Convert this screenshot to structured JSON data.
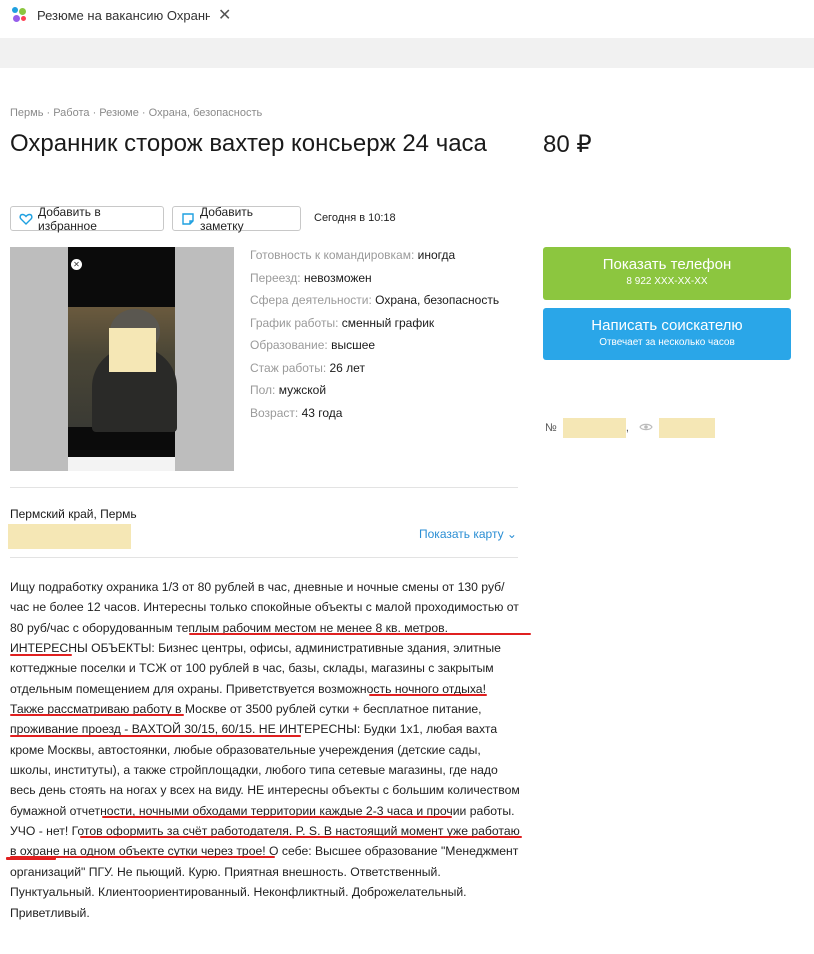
{
  "browser": {
    "tab_title": "Резюме на вакансию Охранник",
    "tab_close": "✕"
  },
  "breadcrumb": "Пермь · Работа · Резюме · Охрана, безопасность",
  "title": "Охранник сторож вахтер консьерж 24 часа",
  "price": "80 ₽",
  "actions": {
    "favorite": "Добавить в избранное",
    "note": "Добавить заметку",
    "date": "Сегодня в 10:18"
  },
  "params": [
    {
      "key": "Готовность к командировкам:",
      "value": "иногда"
    },
    {
      "key": "Переезд:",
      "value": "невозможен"
    },
    {
      "key": "Сфера деятельности:",
      "value": "Охрана, безопасность"
    },
    {
      "key": "График работы:",
      "value": "сменный график"
    },
    {
      "key": "Образование:",
      "value": "высшее"
    },
    {
      "key": "Стаж работы:",
      "value": "26 лет"
    },
    {
      "key": "Пол:",
      "value": "мужской"
    },
    {
      "key": "Возраст:",
      "value": "43 года"
    }
  ],
  "contact": {
    "phone_label": "Показать телефон",
    "phone_masked": "8 922 XXX-XX-XX",
    "message_label": "Написать соискателю",
    "message_sub": "Отвечает за несколько часов"
  },
  "meta": {
    "number_prefix": "№",
    "separator": ","
  },
  "location": {
    "region": "Пермский край, Пермь",
    "show_map": "Показать карту"
  },
  "description": "Ищу подработку охраника 1/3 от 80 рублей в час, дневные и ночные смены от 130 руб/час не более 12 часов. Интересны только спокойные объекты с малой проходимостью от 80 руб/час с оборудованным теплым рабочим местом не менее 8 кв. метров. ИНТЕРЕСНЫ ОБЪЕКТЫ: Бизнес центры, офисы, административные здания, элитные коттеджные поселки и ТСЖ от 100 рублей в час, базы, склады, магазины с закрытым отдельным помещением для охраны. Приветствуется возможность ночного отдыха! Также рассматриваю работу в Москве от 3500 рублей сутки + бесплатное питание, проживание проезд - ВАХТОЙ 30/15, 60/15. НЕ ИНТЕРЕСНЫ: Будки 1х1, любая вахта кроме Москвы, автостоянки, любые образовательные учереждения (детские сады, школы, институты), а также стройплощадки, любого типа сетевые магазины, где надо весь день стоять на ногах у всех на виду. НЕ интересны объекты с большим количеством бумажной отчетности, ночными обходами территории каждые 2-3 часа и прочии работы. УЧО - нет! Готов оформить за счёт работодателя. P. S. В настоящий момент уже работаю в охране на одном объекте сутки через трое! О себе: Высшее образование \"Менеджмент организаций\" ПГУ. Не пьющий. Курю. Приятная внешность. Ответственный. Пунктуальный. Клиентоориентированный. Неконфликтный. Доброжелательный. Приветливый.",
  "colors": {
    "green_button": "#8cc63f",
    "blue_button": "#2aa6e8",
    "link": "#2a8ed4",
    "redaction": "#f5e7b5",
    "underline": "#e02020"
  }
}
